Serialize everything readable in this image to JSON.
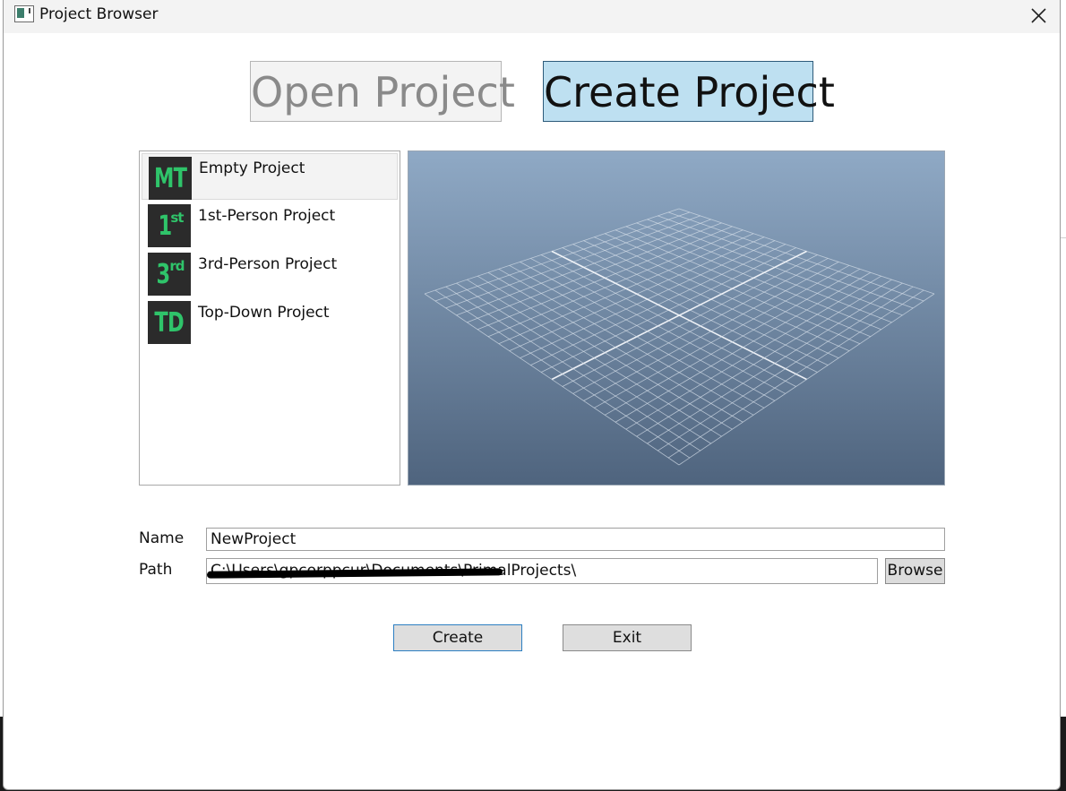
{
  "window": {
    "title": "Project Browser"
  },
  "mode_tabs": {
    "open_label": "Open Project",
    "create_label": "Create Project",
    "active": "create"
  },
  "templates": [
    {
      "icon_main": "MT",
      "icon_sup": "",
      "label": "Empty Project",
      "selected": true
    },
    {
      "icon_main": "1",
      "icon_sup": "st",
      "label": "1st-Person Project",
      "selected": false
    },
    {
      "icon_main": "3",
      "icon_sup": "rd",
      "label": "3rd-Person Project",
      "selected": false
    },
    {
      "icon_main": "TD",
      "icon_sup": "",
      "label": "Top-Down Project",
      "selected": false
    }
  ],
  "form": {
    "name_label": "Name",
    "name_value": "NewProject",
    "path_label": "Path",
    "path_value": "C:\\Users\\gpcorppcur\\Documents\\PrimalProjects\\",
    "browse_label": "Browse"
  },
  "actions": {
    "create_label": "Create",
    "exit_label": "Exit"
  },
  "colors": {
    "titlebar": "#f3f3f3",
    "active_tab": "#bee0f1",
    "template_icon_bg": "#2b2b2b",
    "template_icon_fg": "#2fc46a",
    "preview_top": "#8fa9c5",
    "preview_bottom": "#4f647e",
    "create_button_border": "#2c7fc2"
  },
  "icons": {
    "app": "window-app-icon",
    "close": "close-x-icon"
  }
}
